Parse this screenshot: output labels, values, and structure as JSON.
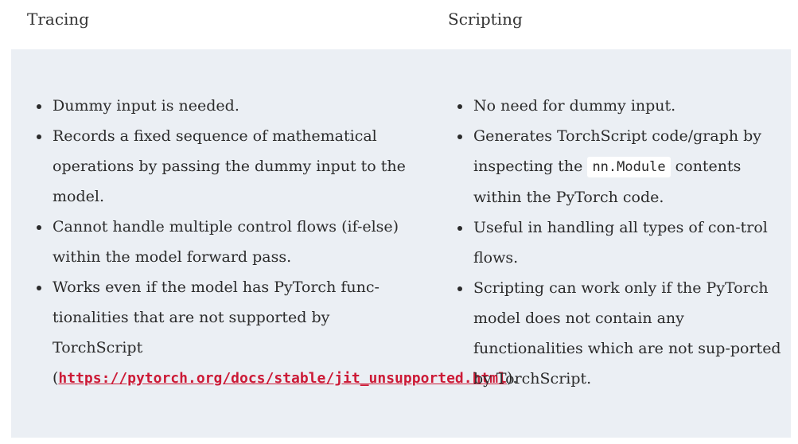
{
  "headers": {
    "left": "Tracing",
    "right": "Scripting"
  },
  "tracing": {
    "items": [
      "Dummy input is needed.",
      "Records a fixed sequence of mathematical operations by passing the dummy input to the model.",
      "Cannot handle multiple control flows (if-else) within the model forward pass.",
      "Works even if the model has PyTorch func-tionalities that are not supported by TorchScript ("
    ],
    "link_text": "https://pytorch.org/docs/stable/jit_unsupported.html",
    "link_suffix": ")."
  },
  "scripting": {
    "item1": "No need for dummy input.",
    "item2_before": "Generates TorchScript code/graph by inspecting the",
    "item2_code": "nn.Module",
    "item2_after": "contents within the PyTorch code.",
    "item3": "Useful in handling all types of con-trol flows.",
    "item4": "Scripting can work only if the PyTorch model does not contain any functionalities which are not sup-ported by TorchScript."
  },
  "colors": {
    "panel_background": "#ebeff4",
    "link": "#cc1a36",
    "text": "#2b2b2b"
  }
}
